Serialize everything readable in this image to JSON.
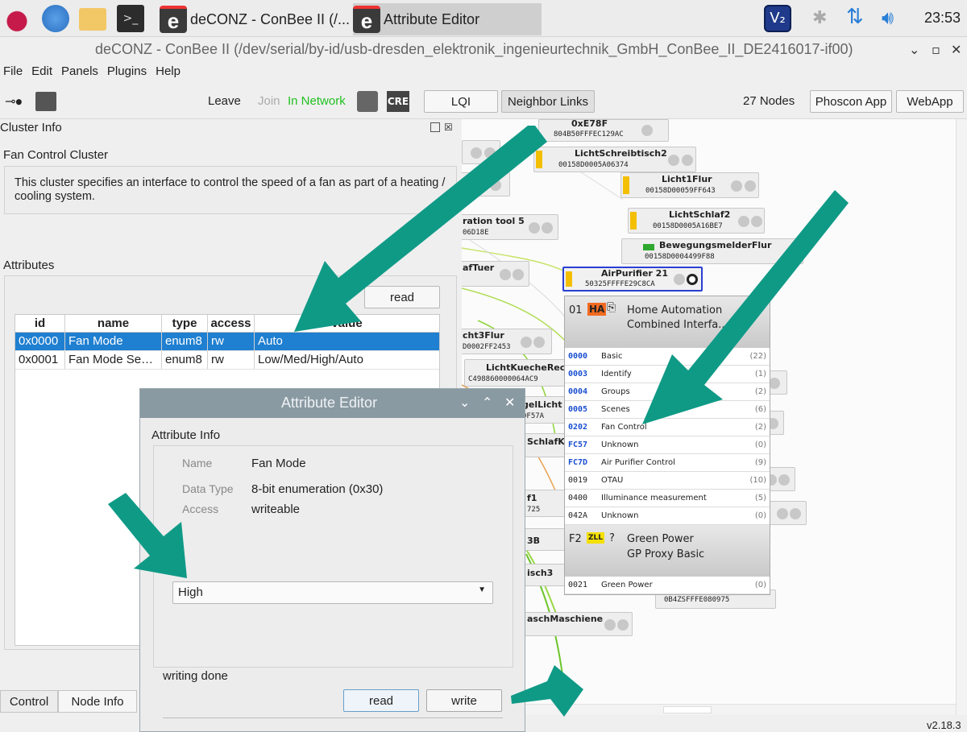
{
  "taskbar": {
    "task1_label": "deCONZ - ConBee II (/...",
    "task2_label": "Attribute Editor",
    "clock": "23:53"
  },
  "window": {
    "title": "deCONZ - ConBee II (/dev/serial/by-id/usb-dresden_elektronik_ingenieurtechnik_GmbH_ConBee_II_DE2416017-if00)"
  },
  "menu": {
    "file": "File",
    "edit": "Edit",
    "panels": "Panels",
    "plugins": "Plugins",
    "help": "Help"
  },
  "toolbar": {
    "leave": "Leave",
    "join": "Join",
    "in_network": "In Network",
    "cre": "CRE",
    "lqi": "LQI",
    "neighbor_links": "Neighbor Links",
    "nodes_count": "27 Nodes",
    "phoscon_app": "Phoscon App",
    "webapp": "WebApp"
  },
  "cluster_info": {
    "panel_title": "Cluster Info",
    "cluster_name": "Fan Control Cluster",
    "description": "This cluster specifies an interface to control the speed of a fan as part of a heating / cooling system.",
    "attributes_label": "Attributes",
    "read_button": "read",
    "columns": [
      "id",
      "name",
      "type",
      "access",
      "value"
    ],
    "rows": [
      {
        "id": "0x0000",
        "name": "Fan Mode",
        "type": "enum8",
        "access": "rw",
        "value": "Auto"
      },
      {
        "id": "0x0001",
        "name": "Fan Mode Se…",
        "type": "enum8",
        "access": "rw",
        "value": "Low/Med/High/Auto"
      }
    ]
  },
  "bottom_tabs": {
    "control": "Control",
    "node_info": "Node Info"
  },
  "graph": {
    "nodes": [
      {
        "name": "0xE78F",
        "addr": "804B50FFFEC129AC"
      },
      {
        "name": "LichtSchreibtisch2",
        "addr": "00158D0005A06374"
      },
      {
        "name": "Licht1Flur",
        "addr": "00158D00059FF643"
      },
      {
        "name": "LichtSchlaf2",
        "addr": "00158D0005A16BE7"
      },
      {
        "name": "BewegungsmelderFlur",
        "addr": "00158D0004499F88"
      },
      {
        "name": "AirPurifier 21",
        "addr": "50325FFFFE29C8CA"
      },
      {
        "name": "ration tool 5",
        "addr": "06D18E"
      },
      {
        "name": "afTuer",
        "addr": ""
      },
      {
        "name": "cht3Flur",
        "addr": "D0002FF2453"
      },
      {
        "name": "LichtKuecheRech",
        "addr": "C498860000064AC9"
      },
      {
        "name": "gelLicht",
        "addr": "0F57A"
      },
      {
        "name": "SchlafKa",
        "addr": ""
      },
      {
        "name": "f1",
        "addr": "725"
      },
      {
        "name": "3B",
        "addr": ""
      },
      {
        "name": "isch3",
        "addr": ""
      },
      {
        "name": "aschMaschiene",
        "addr": ""
      },
      {
        "name": "",
        "addr": "0B4ZSFFFE080975"
      }
    ],
    "version": "v2.18.3"
  },
  "endpoint_popup": {
    "ep1": {
      "num": "01",
      "badge": "HA",
      "line1": "Home Automation",
      "line2": "Combined Interfa..."
    },
    "clusters": [
      {
        "id": "0000",
        "name": "Basic",
        "count": "(22)"
      },
      {
        "id": "0003",
        "name": "Identify",
        "count": "(1)"
      },
      {
        "id": "0004",
        "name": "Groups",
        "count": "(2)"
      },
      {
        "id": "0005",
        "name": "Scenes",
        "count": "(6)"
      },
      {
        "id": "0202",
        "name": "Fan Control",
        "count": "(2)"
      },
      {
        "id": "FC57",
        "name": "Unknown",
        "count": "(0)"
      },
      {
        "id": "FC7D",
        "name": "Air Purifier Control",
        "count": "(9)"
      },
      {
        "id": "0019",
        "name": "OTAU",
        "count": "(10)"
      },
      {
        "id": "0400",
        "name": "Illuminance measurement",
        "count": "(5)"
      },
      {
        "id": "042A",
        "name": "Unknown",
        "count": "(0)"
      }
    ],
    "ep2": {
      "num": "F2",
      "badge": "ZLL",
      "mark": "?",
      "line1": "Green Power",
      "line2": "GP Proxy Basic"
    },
    "gp_cluster": {
      "id": "0021",
      "name": "Green Power",
      "count": "(0)"
    }
  },
  "attribute_editor": {
    "title": "Attribute Editor",
    "section": "Attribute Info",
    "name_key": "Name",
    "name_val": "Fan Mode",
    "type_key": "Data Type",
    "type_val": "8-bit enumeration (0x30)",
    "access_key": "Access",
    "access_val": "writeable",
    "selected_value": "High",
    "status": "writing done",
    "read_button": "read",
    "write_button": "write"
  },
  "colors": {
    "accent_arrow": "#0f9a86",
    "selection": "#1f7fd0",
    "in_network": "#20c020",
    "node_bar": "#f4bf00"
  }
}
